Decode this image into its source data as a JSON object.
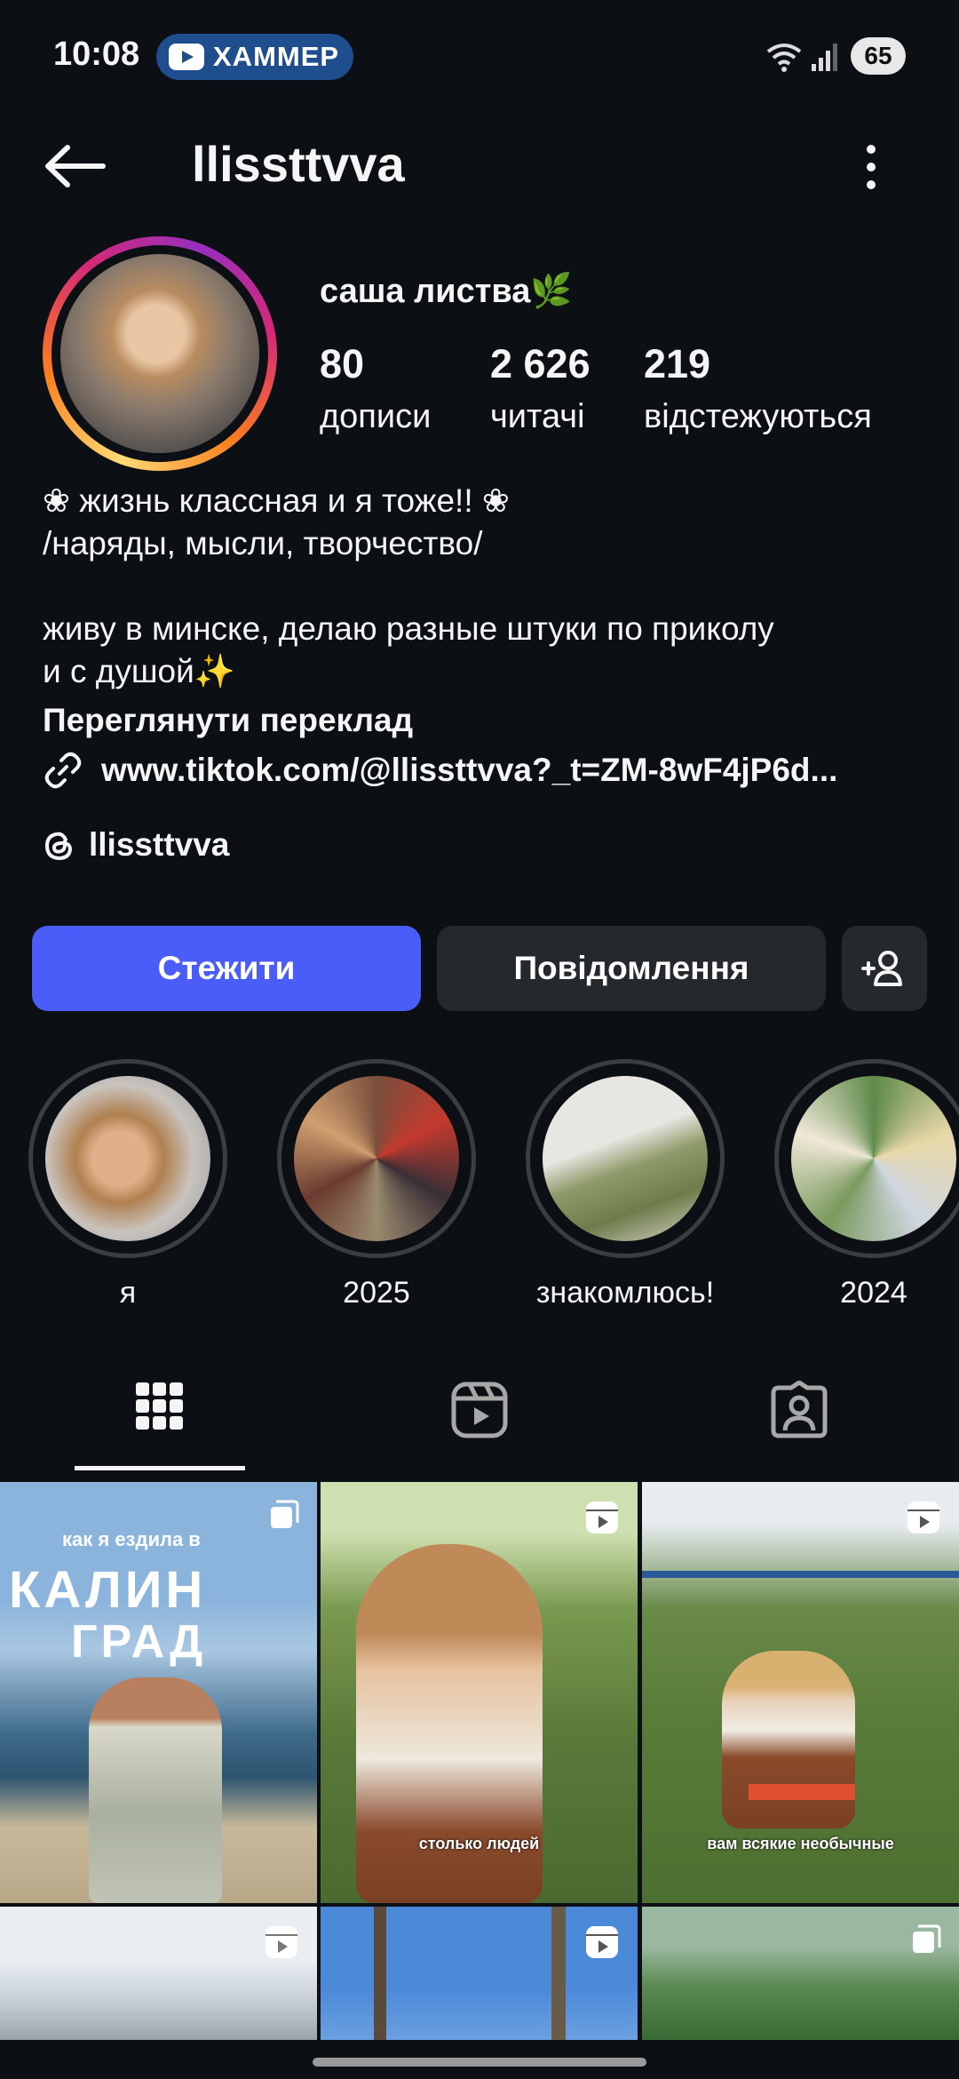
{
  "status_bar": {
    "time": "10:08",
    "yt_notification": "ХАММЕР",
    "battery": "65"
  },
  "header": {
    "username": "llissttvva"
  },
  "profile": {
    "display_name": "саша листва🌿",
    "stats": [
      {
        "value": "80",
        "label": "дописи"
      },
      {
        "value": "2 626",
        "label": "читачі"
      },
      {
        "value": "219",
        "label": "відстежуються"
      }
    ],
    "bio_lines": [
      "❀ жизнь классная и я тоже!! ❀",
      "/наряды, мысли, творчество/",
      "",
      "живу в минске, делаю разные штуки по приколу",
      "и с душой✨"
    ],
    "translate_label": "Переглянути переклад",
    "link": "www.tiktok.com/@llissttvva?_t=ZM-8wF4jP6d...",
    "threads_handle": "llissttvva"
  },
  "buttons": {
    "follow": "Стежити",
    "message": "Повідомлення"
  },
  "highlights": [
    {
      "label": "я"
    },
    {
      "label": "2025"
    },
    {
      "label": "знакомлюсь!"
    },
    {
      "label": "2024"
    }
  ],
  "posts": [
    {
      "caption": "",
      "overlay": [
        "как я ездила в",
        "КАЛИН",
        "ГРАД"
      ],
      "type": "carousel"
    },
    {
      "caption": "столько людей",
      "type": "reel"
    },
    {
      "caption": "вам всякие необычные",
      "type": "reel"
    },
    {
      "caption": "",
      "type": "reel"
    },
    {
      "caption": "",
      "type": "reel"
    },
    {
      "caption": "",
      "type": "carousel"
    }
  ],
  "colors": {
    "background": "#0c1014",
    "follow_button": "#4a5df9",
    "secondary_button": "#25292e"
  }
}
